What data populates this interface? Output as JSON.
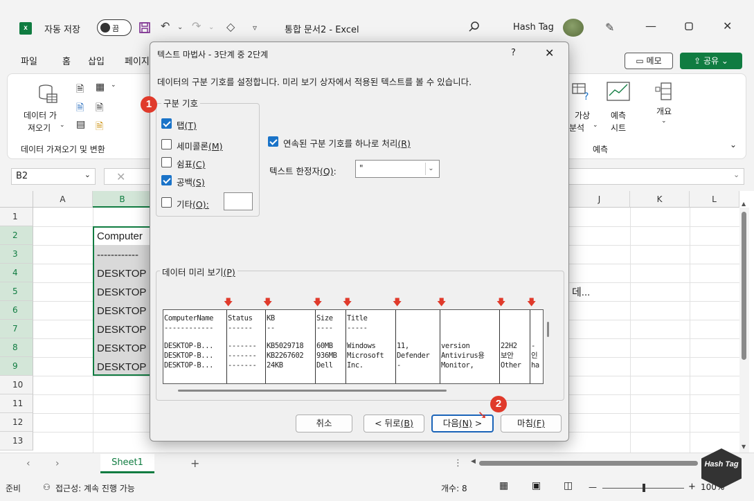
{
  "titlebar": {
    "app_logo": "x",
    "autosave_label": "자동 저장",
    "autosave_state": "끔",
    "doc_title": "통합 문서2  -  Excel",
    "user_name": "Hash Tag"
  },
  "ribbon_tabs": [
    "파일",
    "홈",
    "삽입",
    "페이지"
  ],
  "ribbon_buttons": {
    "memo": "메모",
    "share": "공유"
  },
  "ribbon": {
    "get_data": "데이터 가",
    "get_data2": "져오기",
    "group_label": "데이터 가져오기 및 변환",
    "whatif": "가상",
    "whatif2": "분석",
    "forecast": "예측",
    "forecast2": "시트",
    "outline": "개요",
    "forecast_group": "예측"
  },
  "formula_bar": {
    "name_box": "B2"
  },
  "columns": [
    "A",
    "B",
    "J",
    "K",
    "L"
  ],
  "rows": [
    "1",
    "2",
    "3",
    "4",
    "5",
    "6",
    "7",
    "8",
    "9",
    "10",
    "11",
    "12",
    "13"
  ],
  "cells": {
    "b2": "Computer",
    "b3": "------------",
    "b4": "DESKTOP",
    "b5": "DESKTOP",
    "b6": "DESKTOP",
    "b7": "DESKTOP",
    "b8": "DESKTOP",
    "b9": "DESKTOP",
    "j5": "데..."
  },
  "sheet_tab": "Sheet1",
  "status": {
    "ready": "준비",
    "accessibility": "접근성: 계속 진행 가능",
    "count": "개수: 8",
    "zoom": "100%"
  },
  "dialog": {
    "title": "텍스트 마법사 - 3단계 중 2단계",
    "help": "?",
    "description": "데이터의 구분 기호를 설정합니다. 미리 보기 상자에서 적용된 텍스트를 볼 수 있습니다.",
    "delimiters_legend": "구분 기호",
    "delimiters": [
      {
        "label": "탭",
        "key": "(T)",
        "checked": true
      },
      {
        "label": "세미콜론",
        "key": "(M)",
        "checked": false
      },
      {
        "label": "쉼표",
        "key": "(C)",
        "checked": false
      },
      {
        "label": "공백",
        "key": "(S)",
        "checked": true
      },
      {
        "label": "기타",
        "key": "(O):",
        "checked": false
      }
    ],
    "consecutive_label": "연속된 구분 기호를 하나로 처리",
    "consecutive_key": "(R)",
    "consecutive_checked": true,
    "qualifier_label": "텍스트 한정자",
    "qualifier_key": "(Q)",
    "qualifier_colon": ":",
    "qualifier_value": "\"",
    "preview_legend": "데이터 미리 보기",
    "preview_key": "(P)",
    "preview_columns": [
      [
        "ComputerName",
        "------------",
        "DESKTOP-B...",
        "DESKTOP-B...",
        "DESKTOP-B..."
      ],
      [
        "Status",
        "------",
        "-------",
        "-------",
        "-------"
      ],
      [
        "KB",
        "--",
        "KB5029718",
        "KB2267602",
        "24KB"
      ],
      [
        "Size",
        "----",
        "60MB",
        "936MB",
        "Dell"
      ],
      [
        "Title",
        "-----",
        "Windows",
        "Microsoft",
        "Inc."
      ],
      [
        "",
        "",
        "11,",
        "Defender",
        "-"
      ],
      [
        "",
        "",
        "version",
        "Antivirus용",
        "Monitor,"
      ],
      [
        "",
        "",
        "22H2",
        "보안",
        "Other"
      ],
      [
        "",
        "",
        "-",
        "인",
        "ha"
      ]
    ],
    "buttons": {
      "cancel": "취소",
      "back": "< 뒤로",
      "back_key": "(B)",
      "next": "다음",
      "next_key": "(N)",
      "next_suffix": " >",
      "finish": "마침",
      "finish_key": "(F)"
    }
  },
  "badges": {
    "one": "1",
    "two": "2"
  },
  "watermark": "Hash Tag"
}
